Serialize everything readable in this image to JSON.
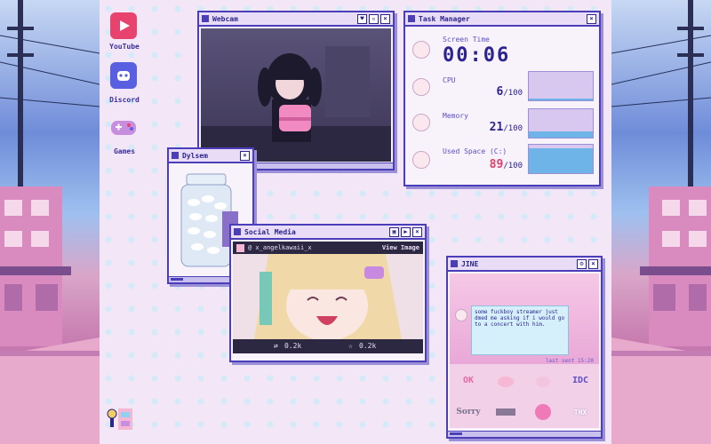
{
  "desktop": {
    "icons": [
      {
        "label": "YouTube",
        "icon": "youtube-icon"
      },
      {
        "label": "Discord",
        "icon": "discord-icon"
      },
      {
        "label": "Games",
        "icon": "gamepad-icon"
      }
    ]
  },
  "webcam": {
    "title": "Webcam"
  },
  "task_manager": {
    "title": "Task Manager",
    "screen_time_label": "Screen Time",
    "screen_time": "00:06",
    "cpu_label": "CPU",
    "cpu_value": "6",
    "cpu_max": "/100",
    "cpu_level": 0.06,
    "memory_label": "Memory",
    "memory_value": "21",
    "memory_max": "/100",
    "memory_level": 0.21,
    "space_label": "Used Space (C:)",
    "space_value": "89",
    "space_max": "/100",
    "space_level": 0.89
  },
  "dylsem": {
    "title": "Dylsem"
  },
  "social": {
    "title": "Social Media",
    "handle": "@ x_angelkawaii_x",
    "view_image": "View Image",
    "retweets": "0.2k",
    "likes": "0.2k"
  },
  "jine": {
    "title": "JINE",
    "message": "some fuckboy streamer just dmed me asking if i would go to a concert with him.",
    "last_sent": "last sent 15:20",
    "stickers": [
      "OK",
      "",
      "",
      "IDC",
      "Sorry",
      "",
      "",
      "THX"
    ]
  },
  "colors": {
    "accent": "#4a3fb8",
    "bar_fill": "#6fb4e8",
    "bar_bg": "#d8c8f0",
    "warn": "#e0406a"
  }
}
